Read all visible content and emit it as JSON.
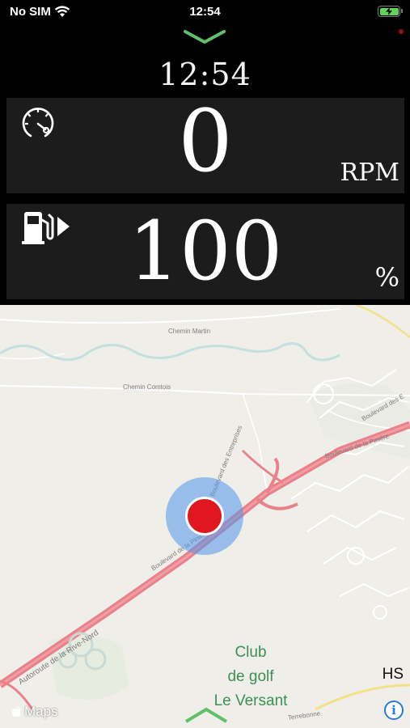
{
  "status_bar": {
    "carrier": "No SIM",
    "time": "12:54",
    "battery_charging": true
  },
  "header": {
    "collapse_icon": "chevron-down-icon",
    "clock": "12:54"
  },
  "gauges": {
    "rpm": {
      "icon": "speedometer-icon",
      "value": "0",
      "unit": "RPM"
    },
    "fuel": {
      "icon": "fuel-pump-icon",
      "value": "100",
      "unit": "%"
    }
  },
  "map": {
    "labels": {
      "chemin_martin": "Chemin Martin",
      "chemin_comtois": "Chemin Comtois",
      "boulevard_des_1": "Boulevard des E",
      "boulevard_pinere": "Boulevard de la Pinière",
      "boulevard_entreprises": "Boulevard des Entreprises",
      "boulevard_pinere_2": "Boulevard de la Pinière",
      "autoroute": "Autoroute de la Rive-Nord",
      "terrebonne": "Terrebonne"
    },
    "golf_line1": "Club",
    "golf_line2": "de golf",
    "golf_line3": "Le Versant",
    "heading": "HS",
    "attribution": "Maps",
    "info_button": "i"
  },
  "colors": {
    "panel_bg": "#1c1c1c",
    "accent_green": "#5fbf6a",
    "location_red": "#e0171e",
    "location_halo": "#5096eb",
    "highway": "#e8818a",
    "golf_text": "#3e8f56",
    "info_blue": "#2a78d8"
  }
}
